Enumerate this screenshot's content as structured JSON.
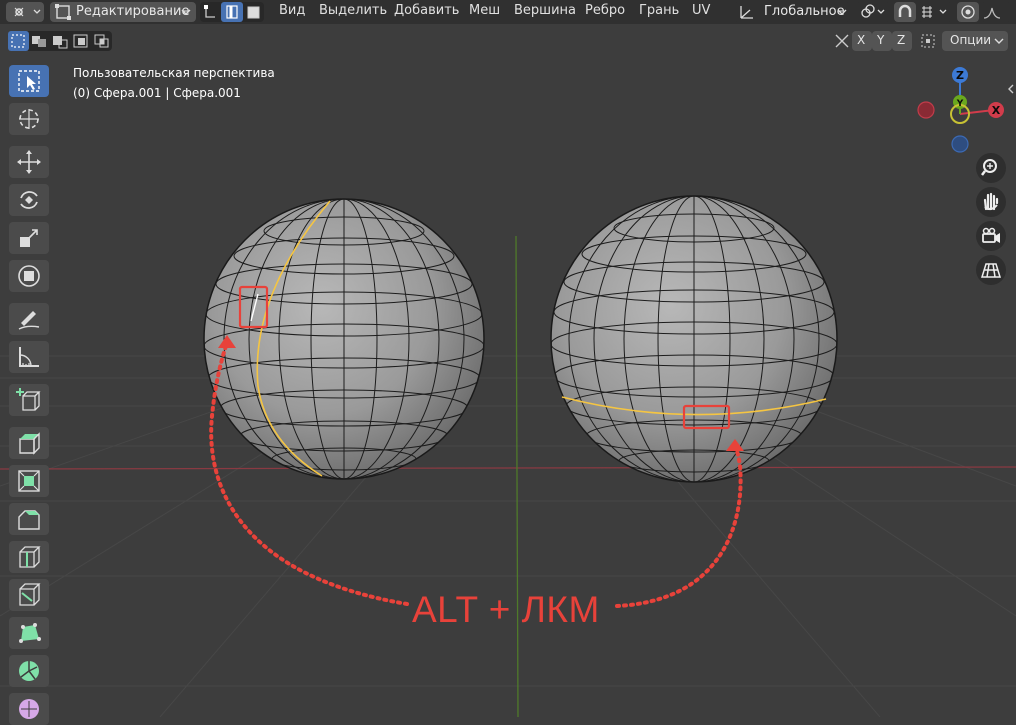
{
  "header": {
    "mode_select": "Редактирование",
    "menu": [
      "Вид",
      "Выделить",
      "Добавить",
      "Меш",
      "Вершина",
      "Ребро",
      "Грань",
      "UV"
    ],
    "orientation": "Глобальное"
  },
  "toolbar2": {
    "axis_x": "X",
    "axis_y": "Y",
    "axis_z": "Z",
    "options": "Опции"
  },
  "viewport": {
    "view_name": "Пользовательская перспектива",
    "object_info": "(0) Сфера.001 | Сфера.001",
    "gizmo_labels": {
      "z": "Z",
      "y": "Y",
      "x": "X"
    }
  },
  "annotation": {
    "shortcut": "ALT + ЛКМ",
    "color": "#e8423a"
  },
  "colors": {
    "header_bg": "#303030",
    "viewport_bg": "#3d3d3d",
    "active_blue": "#4772b3",
    "edge_loop_yellow": "#f5c542",
    "axis_red": "#b3323c",
    "axis_green": "#6aa81e"
  },
  "tools": [
    "select-box",
    "cursor",
    "move",
    "rotate",
    "scale",
    "transform",
    "annotate",
    "measure",
    "add-cube",
    "extrude",
    "inset",
    "bevel",
    "loop-cut",
    "knife",
    "poly-build",
    "spin",
    "smooth",
    "shrink"
  ]
}
